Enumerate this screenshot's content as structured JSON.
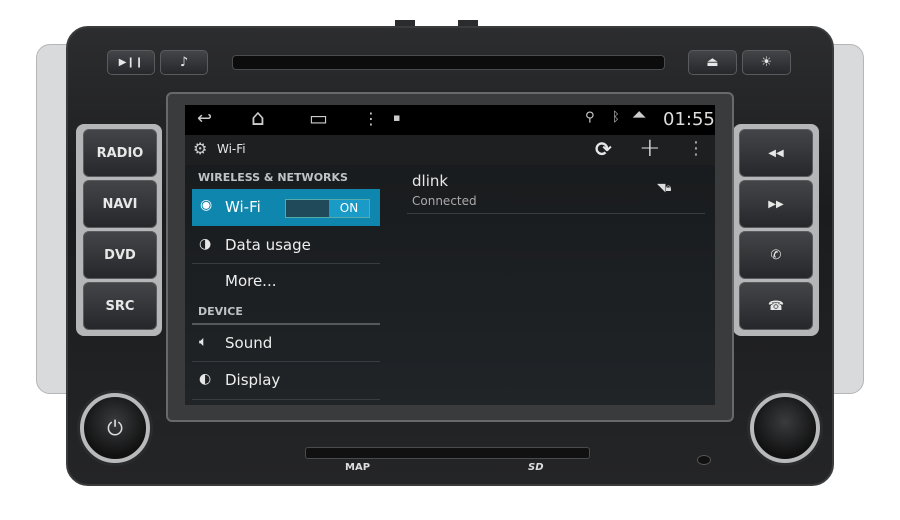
{
  "hardware": {
    "left_buttons": [
      "RADIO",
      "NAVI",
      "DVD",
      "SRC"
    ],
    "right_buttons": [
      {
        "icon": "rewind-icon",
        "glyph": "◀◀"
      },
      {
        "icon": "fast-forward-icon",
        "glyph": "▶▶"
      },
      {
        "icon": "phone-answer-icon",
        "glyph": "✆"
      },
      {
        "icon": "phone-hangup-icon",
        "glyph": "☎"
      }
    ],
    "top_left": [
      {
        "icon": "play-pause-icon",
        "glyph": "▶❙❙"
      },
      {
        "icon": "music-note-icon",
        "glyph": "♪"
      }
    ],
    "top_right": [
      {
        "icon": "eject-icon",
        "glyph": "⏏"
      },
      {
        "icon": "brightness-icon",
        "glyph": "☀"
      }
    ],
    "power_glyph": "⏻",
    "map_label": "MAP",
    "sd_label": "SD"
  },
  "status_bar": {
    "time": "01:55",
    "nav_back": "↩",
    "nav_home": "⌂",
    "nav_recent": "▭",
    "nav_menu": "⋮",
    "notif": "▪",
    "location": "⚲",
    "bluetooth": "ᛒ",
    "wifi": "◥"
  },
  "action_bar": {
    "title": "Wi-Fi",
    "refresh_glyph": "⟳",
    "add_glyph": "+",
    "overflow_glyph": "⋮"
  },
  "settings": {
    "section_wireless": "WIRELESS & NETWORKS",
    "wifi": {
      "label": "Wi-Fi",
      "toggle": "ON",
      "state": true
    },
    "data_usage": "Data usage",
    "more": "More...",
    "section_device": "DEVICE",
    "sound": "Sound",
    "display": "Display"
  },
  "networks": [
    {
      "ssid": "dlink",
      "status": "Connected",
      "secured": true
    }
  ],
  "colors": {
    "accent": "#0f86ad",
    "toggle_on": "#1a9bc7"
  }
}
